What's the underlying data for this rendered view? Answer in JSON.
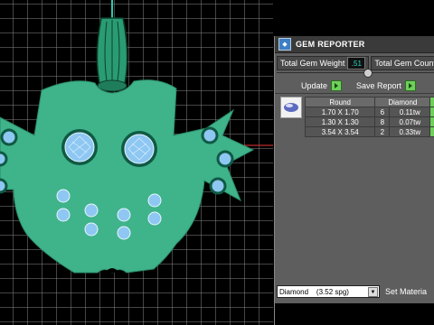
{
  "panel": {
    "title": "GEM REPORTER",
    "icon": "gem-reporter-icon",
    "total_weight_label": "Total Gem Weight",
    "total_weight_value": ".51",
    "total_count_label": "Total Gem Count"
  },
  "actions": {
    "update_label": "Update",
    "save_report_label": "Save Report",
    "update_run_icon": "play-icon",
    "save_run_icon": "play-icon"
  },
  "table": {
    "headers": [
      "Round",
      "Diamond"
    ],
    "rows": [
      {
        "size": "1.70 X 1.70",
        "count": "6",
        "weight": "0.11tw"
      },
      {
        "size": "1.30 X 1.30",
        "count": "8",
        "weight": "0.07tw"
      },
      {
        "size": "3.54 X 3.54",
        "count": "2",
        "weight": "0.33tw"
      }
    ]
  },
  "material": {
    "selected": "Diamond    (3.52 spg)",
    "set_label": "Set Materia"
  },
  "colors": {
    "model": "#3fb38a",
    "stone": "#8ec7f2",
    "accent_play": "#6ed05a",
    "value_text": "#29d7c4"
  }
}
